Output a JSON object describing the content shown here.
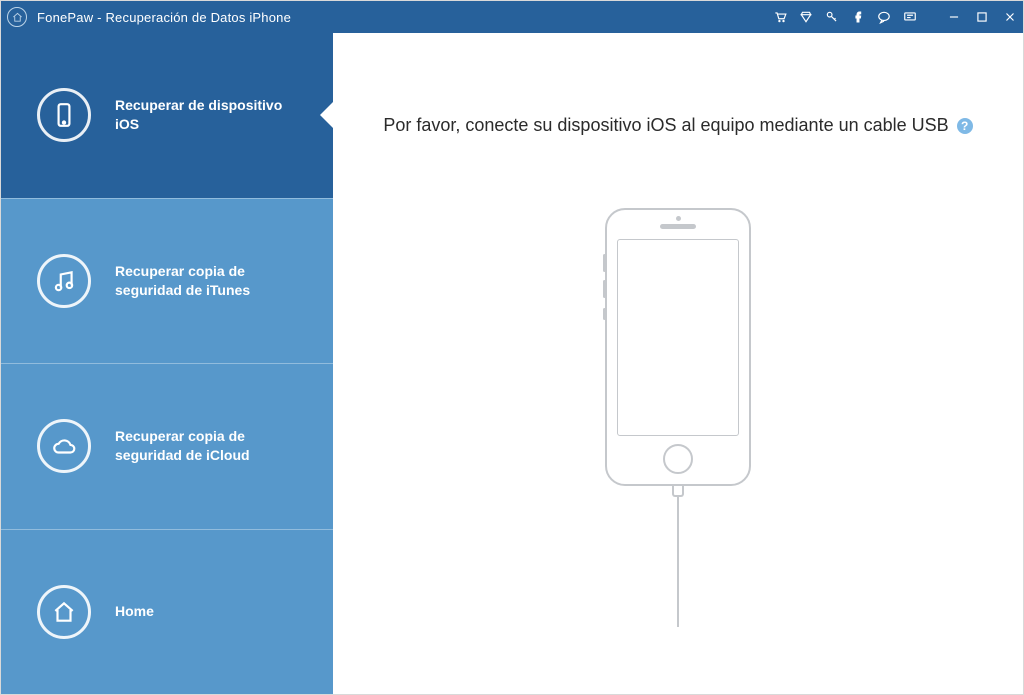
{
  "titlebar": {
    "title": "FonePaw - Recuperación de Datos iPhone"
  },
  "sidebar": {
    "items": [
      {
        "label": "Recuperar de dispositivo iOS"
      },
      {
        "label": "Recuperar copia de seguridad de iTunes"
      },
      {
        "label": "Recuperar copia de seguridad de iCloud"
      },
      {
        "label": "Home"
      }
    ]
  },
  "main": {
    "instruction": "Por favor, conecte su dispositivo iOS al equipo mediante un cable USB",
    "help_symbol": "?"
  }
}
